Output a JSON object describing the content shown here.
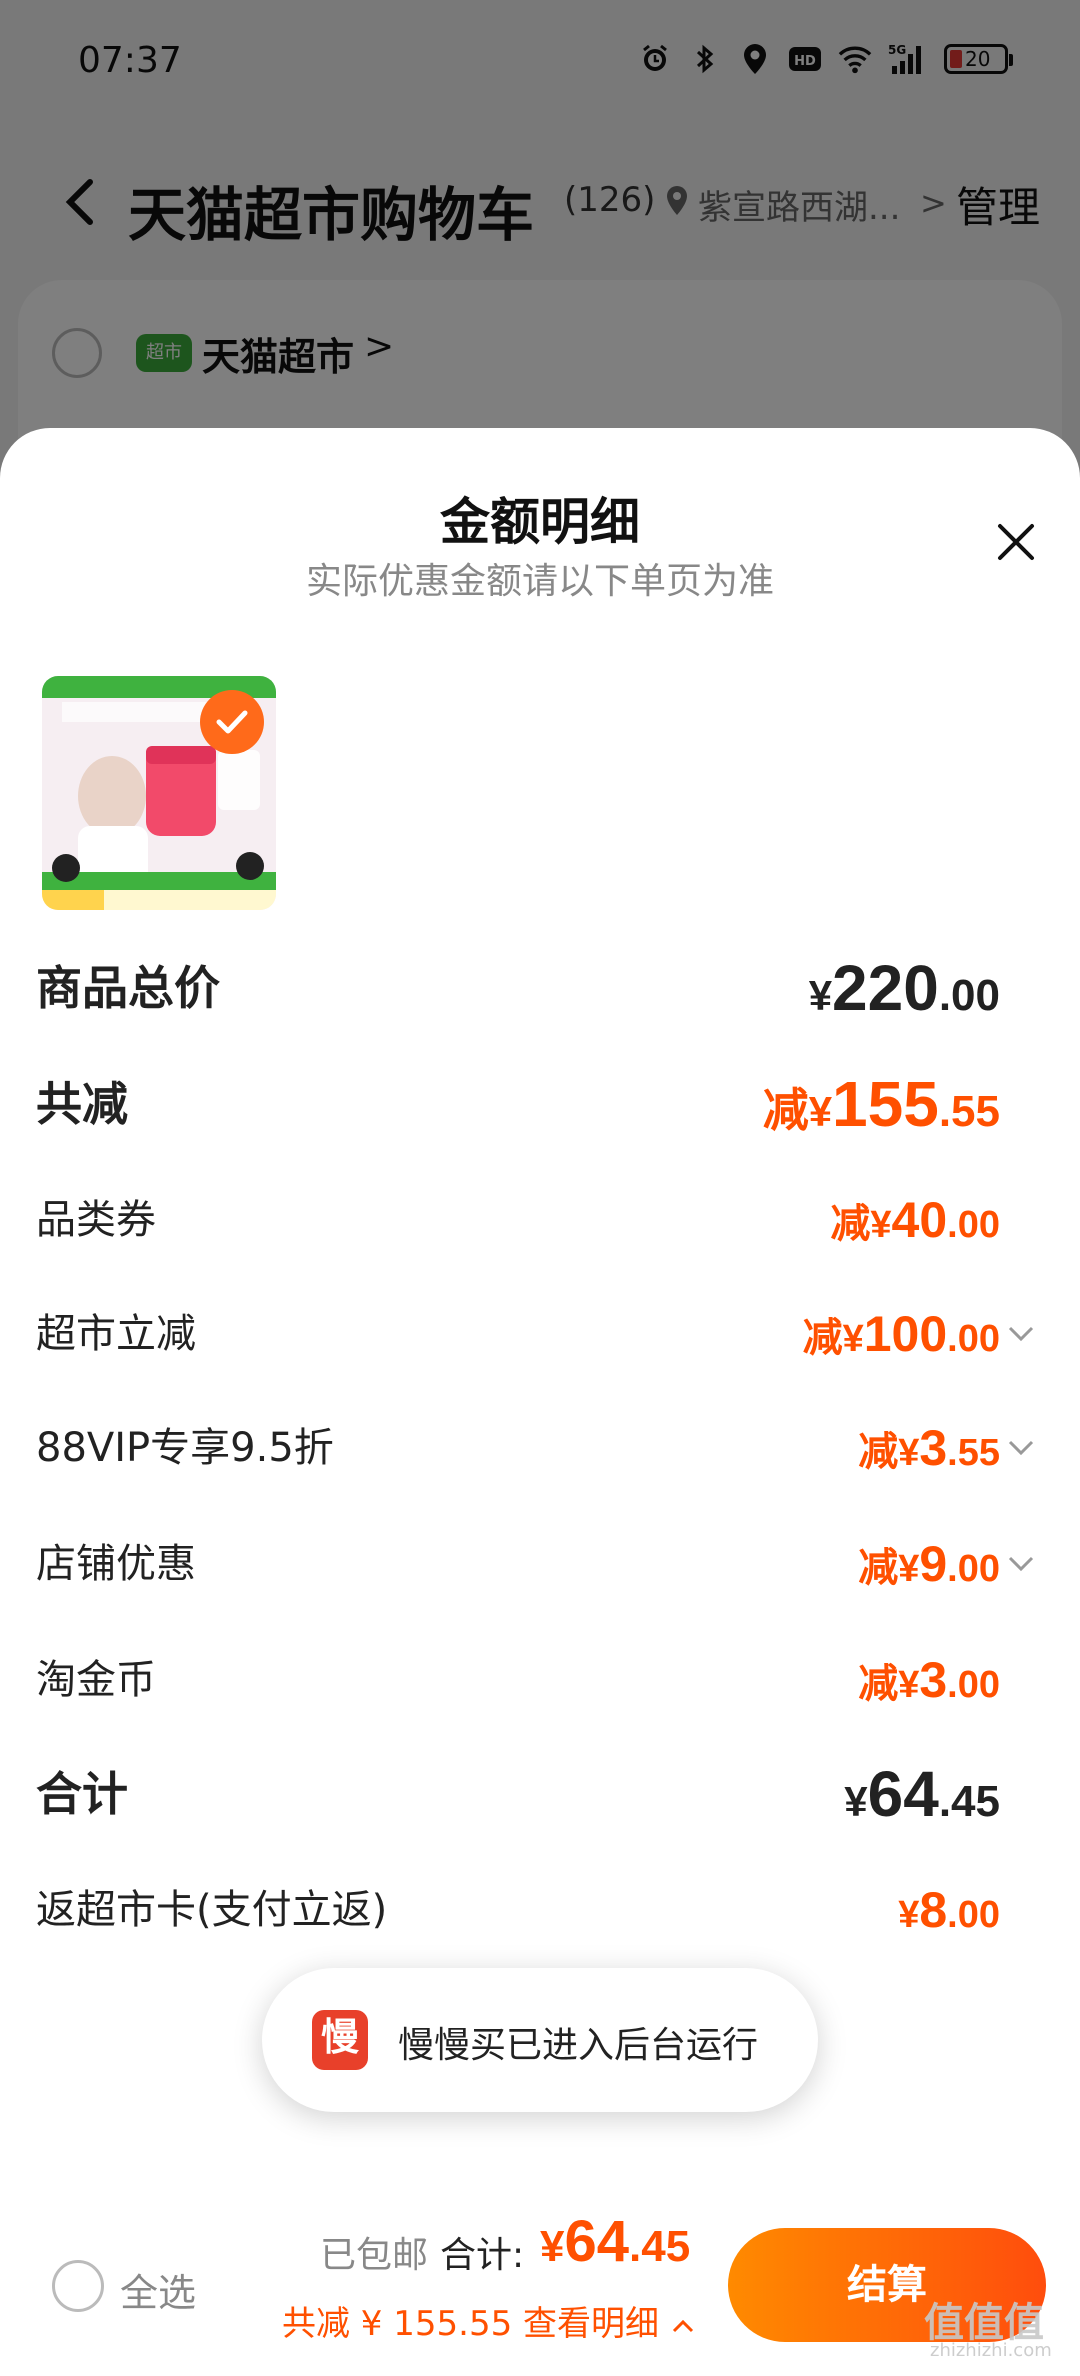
{
  "status_bar": {
    "time": "07:37",
    "network": "5G",
    "battery": "20",
    "icons": [
      "alarm-icon",
      "bluetooth-icon",
      "location-icon",
      "hd-icon",
      "wifi-icon",
      "signal-icon",
      "battery-icon"
    ]
  },
  "cart_header": {
    "title": "天猫超市购物车",
    "count": "(126)",
    "location": "紫宣路西湖...",
    "location_arrow": ">",
    "manage": "管理"
  },
  "store": {
    "badge": "超市",
    "name": "天猫超市",
    "arrow": ">"
  },
  "sheet": {
    "title": "金额明细",
    "subtitle": "实际优惠金额请以下单页为准",
    "product_image_alt": "AUPRES product",
    "rows": [
      {
        "label": "商品总价",
        "prefix": "",
        "currency": "¥",
        "int": "220",
        "dec": ".00"
      },
      {
        "label": "共减",
        "prefix": "减",
        "currency": "¥",
        "int": "155",
        "dec": ".55"
      },
      {
        "label": "品类券",
        "prefix": "减",
        "currency": "¥",
        "int": "40",
        "dec": ".00"
      },
      {
        "label": "超市立减",
        "prefix": "减",
        "currency": "¥",
        "int": "100",
        "dec": ".00"
      },
      {
        "label": "88VIP专享9.5折",
        "prefix": "减",
        "currency": "¥",
        "int": "3",
        "dec": ".55"
      },
      {
        "label": "店铺优惠",
        "prefix": "减",
        "currency": "¥",
        "int": "9",
        "dec": ".00"
      },
      {
        "label": "淘金币",
        "prefix": "减",
        "currency": "¥",
        "int": "3",
        "dec": ".00"
      },
      {
        "label": "合计",
        "prefix": "",
        "currency": "¥",
        "int": "64",
        "dec": ".45"
      },
      {
        "label": "返超市卡(支付立返)",
        "prefix": "",
        "currency": "¥",
        "int": "8",
        "dec": ".00"
      }
    ]
  },
  "toast": {
    "icon_text": "慢",
    "text": "慢慢买已进入后台运行"
  },
  "bottom_bar": {
    "select_all": "全选",
    "shipping": "已包邮",
    "total_label": "合计:",
    "total_currency": "¥",
    "total_int": "64",
    "total_dec": ".45",
    "reduced": "共减 ¥ 155.55  查看明细",
    "checkout": "结算"
  },
  "watermark": {
    "main": "值值值",
    "sub": "zhizhizhi.com"
  },
  "colors": {
    "accent": "#ff5000",
    "checkout_start": "#ff8a00",
    "checkout_end": "#ff4d0d"
  }
}
